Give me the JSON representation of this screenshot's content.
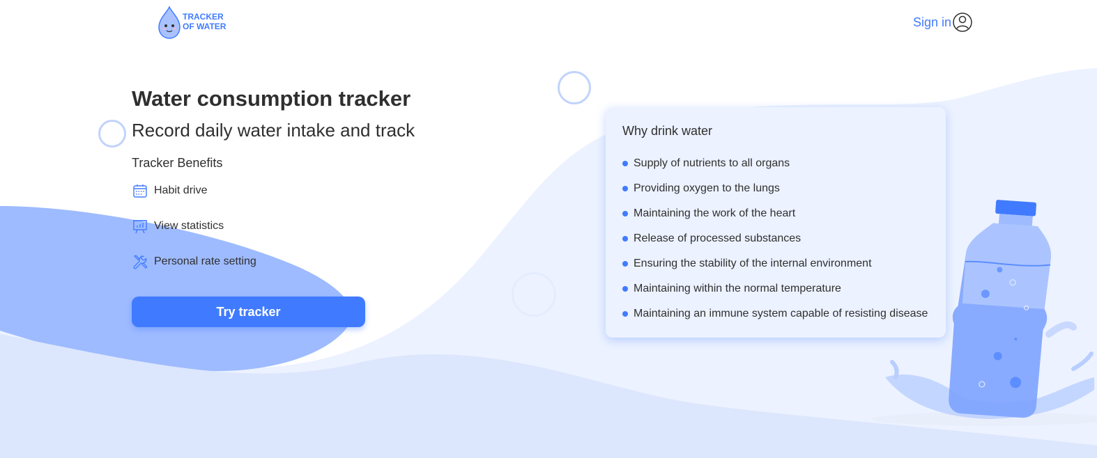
{
  "header": {
    "logo_line1": "TRACKER",
    "logo_line2": "OF WATER",
    "signin_label": "Sign in"
  },
  "hero": {
    "title": "Water consumption tracker",
    "subtitle": "Record daily water intake and track",
    "benefits_heading": "Tracker Benefits",
    "benefits": [
      {
        "label": "Habit drive",
        "icon": "calendar-icon"
      },
      {
        "label": "View statistics",
        "icon": "presentation-chart-icon"
      },
      {
        "label": "Personal rate setting",
        "icon": "wrench-screwdriver-icon"
      }
    ],
    "cta_label": "Try tracker"
  },
  "card": {
    "heading": "Why drink water",
    "items": [
      "Supply of nutrients to all organs",
      "Providing oxygen to the lungs",
      "Maintaining the work of the heart",
      "Release of processed substances",
      "Ensuring the stability of the internal environment",
      "Maintaining within the normal temperature",
      "Maintaining an immune system capable of resisting disease"
    ]
  },
  "colors": {
    "accent": "#407bff",
    "text": "#2f2f2f",
    "card_bg": "#ecf2ff",
    "wave_light": "#ecf2ff",
    "wave_dark": "#9ebbff"
  }
}
